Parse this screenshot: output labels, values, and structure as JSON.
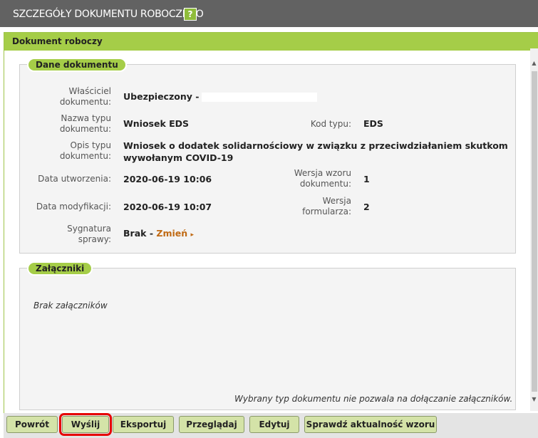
{
  "window": {
    "title": "SZCZEGÓŁY DOKUMENTU ROBOCZEGO",
    "help_label": "?"
  },
  "panel": {
    "title": "Dokument roboczy"
  },
  "document": {
    "legend": "Dane dokumentu",
    "owner_label_1": "Właściciel",
    "owner_label_2": "dokumentu:",
    "owner_value": "Ubezpieczony -",
    "type_name_label_1": "Nazwa typu",
    "type_name_label_2": "dokumentu:",
    "type_name_value": "Wniosek EDS",
    "type_code_label": "Kod typu:",
    "type_code_value": "EDS",
    "desc_label_1": "Opis typu",
    "desc_label_2": "dokumentu:",
    "desc_value_1": "Wniosek o dodatek solidarnościowy w związku z przeciwdziałaniem skutkom",
    "desc_value_2": "wywołanym COVID-19",
    "created_label": "Data utworzenia:",
    "created_value": "2020-06-19 10:06",
    "template_version_label_1": "Wersja wzoru",
    "template_version_label_2": "dokumentu:",
    "template_version_value": "1",
    "modified_label": "Data modyfikacji:",
    "modified_value": "2020-06-19 10:07",
    "form_version_label_1": "Wersja",
    "form_version_label_2": "formularza:",
    "form_version_value": "2",
    "signature_label_1": "Sygnatura",
    "signature_label_2": "sprawy:",
    "signature_value": "Brak",
    "signature_sep": "-",
    "signature_link": "Zmień",
    "signature_arrow": "▸"
  },
  "attachments": {
    "legend": "Załączniki",
    "empty_text": "Brak załączników",
    "note": "Wybrany typ dokumentu nie pozwala na dołączanie załączników."
  },
  "buttons": {
    "back": "Powrót",
    "send": "Wyślij",
    "export": "Eksportuj",
    "view": "Przeglądaj",
    "edit": "Edytuj",
    "check_template": "Sprawdź aktualność wzoru"
  },
  "colors": {
    "accent_green": "#a5cd48",
    "title_gray": "#626262",
    "link_orange": "#c06a14",
    "highlight_red": "#e60000"
  },
  "icons": {
    "help": "help-icon",
    "scroll_up": "scroll-up-icon",
    "scroll_down": "scroll-down-icon",
    "link_arrow": "arrow-right-icon"
  }
}
